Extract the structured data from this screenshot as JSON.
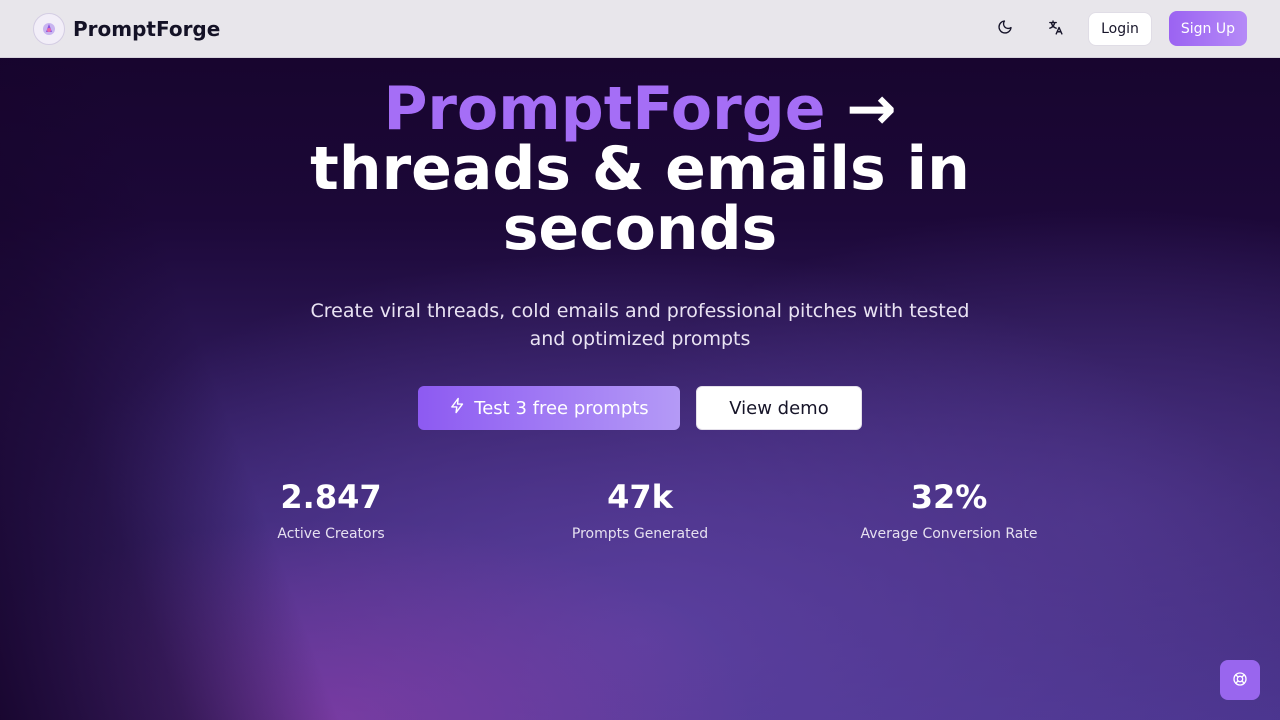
{
  "brand": {
    "name": "PromptForge",
    "logo_icon": "wizard-icon"
  },
  "nav": {
    "theme_icon": "moon-icon",
    "language_icon": "translate-icon",
    "login_label": "Login",
    "signup_label": "Sign Up"
  },
  "hero": {
    "headline_accent": "PromptForge",
    "headline_arrow": "→",
    "headline_line2": "threads & emails in",
    "headline_line3": "seconds",
    "subtitle": "Create viral threads, cold emails and professional pitches with tested and optimized prompts",
    "cta_primary": "Test 3 free prompts",
    "cta_primary_icon": "lightning-icon",
    "cta_secondary": "View demo"
  },
  "stats": [
    {
      "value": "2.847",
      "label": "Active Creators"
    },
    {
      "value": "47k",
      "label": "Prompts Generated"
    },
    {
      "value": "32%",
      "label": "Average Conversion Rate"
    }
  ],
  "support": {
    "icon": "lifebuoy-icon"
  },
  "colors": {
    "accent": "#a56ef6",
    "button_gradient_start": "#8d5af2",
    "button_gradient_end": "#b49af6",
    "navbar_bg": "#e8e6eb",
    "hero_bg_dark": "#16042b"
  }
}
